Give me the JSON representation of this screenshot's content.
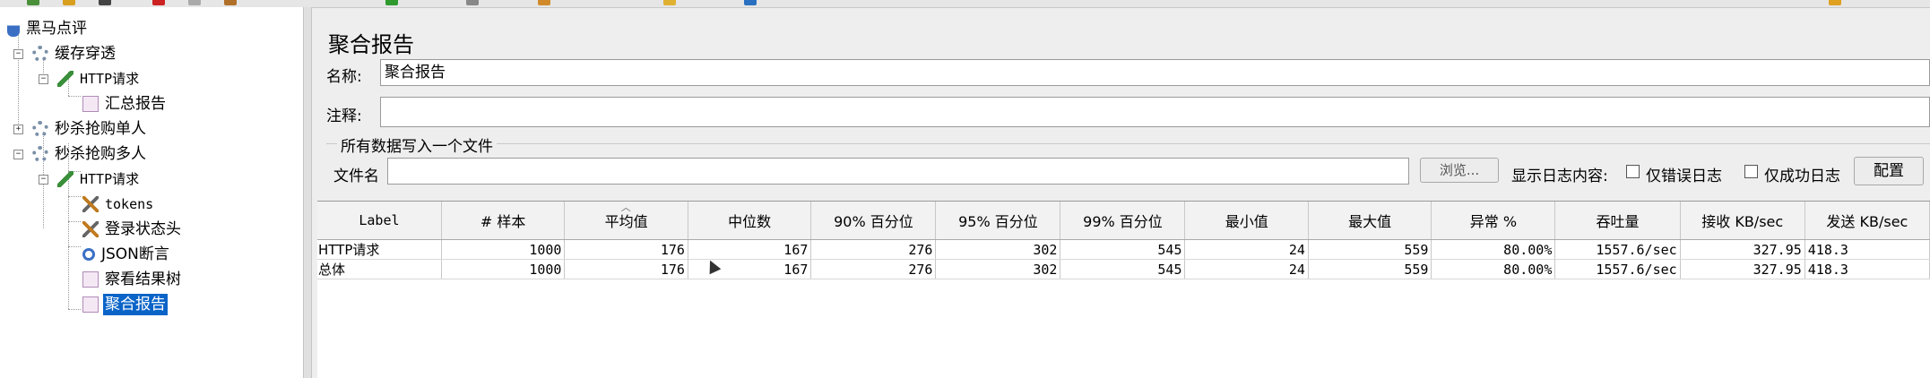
{
  "tree": {
    "root": "黑马点评",
    "items": [
      {
        "label": "缓存穿透"
      },
      {
        "label": "HTTP请求"
      },
      {
        "label": "汇总报告"
      },
      {
        "label": "秒杀抢购单人"
      },
      {
        "label": "秒杀抢购多人"
      },
      {
        "label": "HTTP请求"
      },
      {
        "label": "tokens"
      },
      {
        "label": "登录状态头"
      },
      {
        "label": "JSON断言"
      },
      {
        "label": "察看结果树"
      },
      {
        "label": "聚合报告"
      }
    ]
  },
  "panel": {
    "title": "聚合报告",
    "name_label": "名称:",
    "name_value": "聚合报告",
    "comment_label": "注释:",
    "comment_value": "",
    "file_group_title": "所有数据写入一个文件",
    "filename_label": "文件名",
    "filename_value": "",
    "browse_button": "浏览...",
    "log_display_label": "显示日志内容:",
    "errors_only_label": "仅错误日志",
    "success_only_label": "仅成功日志",
    "configure_button": "配置"
  },
  "table": {
    "columns": [
      "Label",
      "# 样本",
      "平均值",
      "中位数",
      "90% 百分位",
      "95% 百分位",
      "99% 百分位",
      "最小值",
      "最大值",
      "异常 %",
      "吞吐量",
      "接收 KB/sec",
      "发送 KB/sec"
    ],
    "rows": [
      [
        "HTTP请求",
        "1000",
        "176",
        "167",
        "276",
        "302",
        "545",
        "24",
        "559",
        "80.00%",
        "1557.6/sec",
        "327.95",
        "418.3"
      ],
      [
        "总体",
        "1000",
        "176",
        "167",
        "276",
        "302",
        "545",
        "24",
        "559",
        "80.00%",
        "1557.6/sec",
        "327.95",
        "418.3"
      ]
    ]
  },
  "colors": {
    "selection": "#0a64c8",
    "background": "#eeeeee"
  }
}
